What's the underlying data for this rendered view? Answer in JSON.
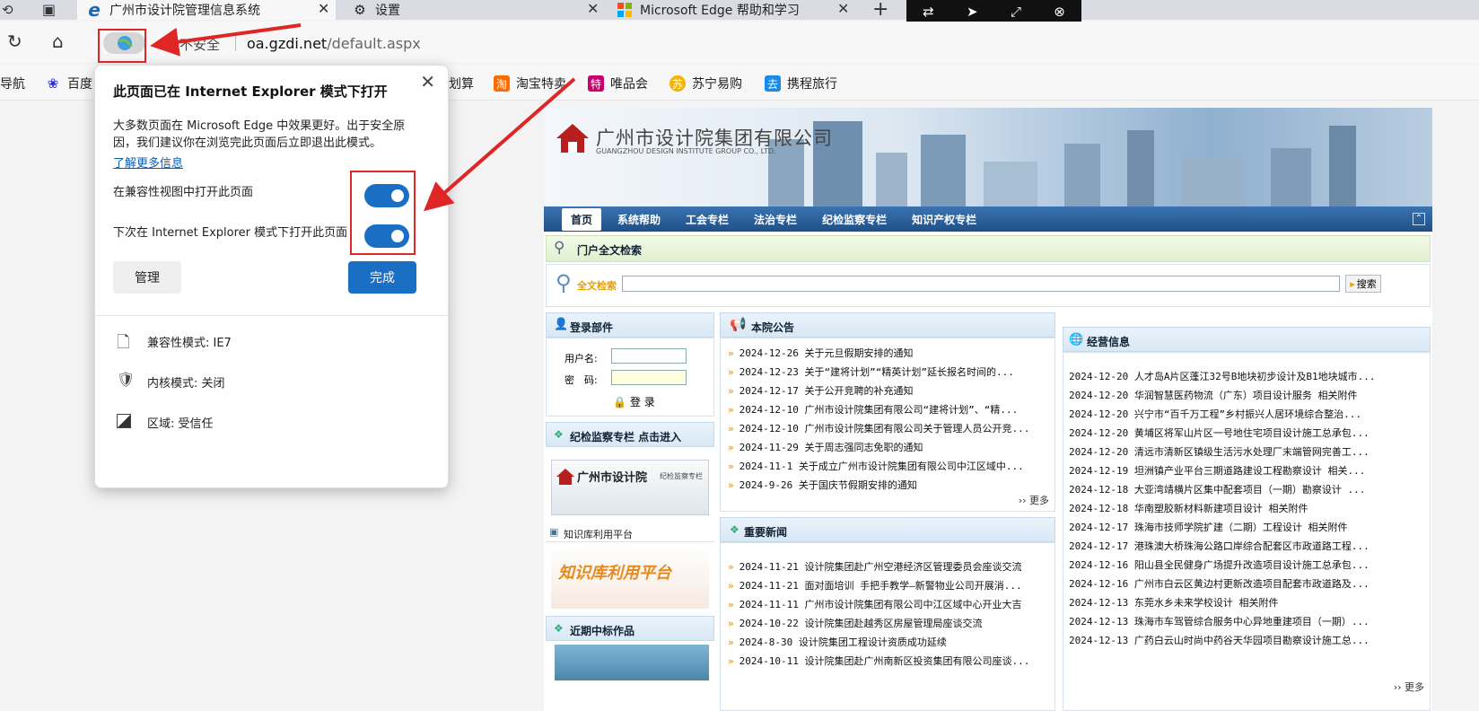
{
  "tabs": [
    {
      "label": "广州市设计院管理信息系统",
      "icon": "ie-icon"
    },
    {
      "label": "设置",
      "icon": "gear-icon"
    },
    {
      "label": "Microsoft Edge 帮助和学习",
      "icon": "microsoft-logo-icon"
    }
  ],
  "address": {
    "security": "不安全",
    "domain": "oa.gzdi.net",
    "path": "/default.aspx"
  },
  "bookmarks": [
    "导航",
    "百度",
    "划算",
    "淘宝特卖",
    "唯品会",
    "苏宁易购",
    "携程旅行"
  ],
  "popup": {
    "title": "此页面已在 Internet Explorer 模式下打开",
    "body": "大多数页面在 Microsoft Edge 中效果更好。出于安全原因，我们建议你在浏览完此页面后立即退出此模式。",
    "learn_more": "了解更多信息",
    "toggle1": "在兼容性视图中打开此页面",
    "toggle2": "下次在 Internet Explorer 模式下打开此页面",
    "manage": "管理",
    "done": "完成",
    "compat": "兼容性模式: IE7",
    "kernel": "内核模式: 关闭",
    "zone": "区域: 受信任"
  },
  "site": {
    "company": "广州市设计院集团有限公司",
    "company_en": "GUANGZHOU DESIGN INSTITUTE GROUP CO., LTD.",
    "nav": [
      "首页",
      "系统帮助",
      "工会专栏",
      "法治专栏",
      "纪检监察专栏",
      "知识产权专栏"
    ],
    "search_title": "门户全文检索",
    "search_label": "全文检索",
    "search_btn": "搜索",
    "login_title": "登录部件",
    "username": "用户名:",
    "password": "密　码:",
    "login_btn": "登 录",
    "discipline_title": "纪检监察专栏 点击进入",
    "discipline_banner": "广州市设计院",
    "discipline_sub": "纪检监察专栏",
    "knowledge_title": "知识库利用平台",
    "knowledge_banner": "知识库利用平台",
    "bids_title": "近期中标作品",
    "notice_title": "本院公告",
    "notices": [
      "2024-12-26 关于元旦假期安排的通知",
      "2024-12-23 关于“建将计划”“精英计划”延长报名时间的...",
      "2024-12-17 关于公开竞聘的补充通知",
      "2024-12-10 广州市设计院集团有限公司“建将计划”、“精...",
      "2024-12-10 广州市设计院集团有限公司关于管理人员公开竞...",
      "2024-11-29 关于周志强同志免职的通知",
      "2024-11-1 关于成立广州市设计院集团有限公司中江区域中...",
      "2024-9-26 关于国庆节假期安排的通知"
    ],
    "more": "›› 更多",
    "news_title": "重要新闻",
    "news": [
      "2024-11-21 设计院集团赴广州空港经济区管理委员会座谈交流",
      "2024-11-21 面对面培训 手把手教学—新警物业公司开展消...",
      "2024-11-11 广州市设计院集团有限公司中江区域中心开业大吉",
      "2024-10-22 设计院集团赴越秀区房屋管理局座谈交流",
      "2024-8-30 设计院集团工程设计资质成功延续",
      "2024-10-11 设计院集团赴广州南新区投资集团有限公司座谈..."
    ],
    "business_title": "经营信息",
    "business": [
      "2024-12-20 人才岛A片区蓬江32号B地块初步设计及B1地块城市...",
      "2024-12-20 华润智慧医药物流（广东）项目设计服务 相关附件",
      "2024-12-20 兴宁市“百千万工程”乡村振兴人居环境综合整治...",
      "2024-12-20 黄埔区将军山片区一号地住宅项目设计施工总承包...",
      "2024-12-20 清远市清新区镇级生活污水处理厂末端管网完善工...",
      "2024-12-19 坦洲镇产业平台三期道路建设工程勘察设计 相关...",
      "2024-12-18 大亚湾靖横片区集中配套项目（一期）勘察设计 ...",
      "2024-12-18 华南塑胶新材料新建项目设计 相关附件",
      "2024-12-17 珠海市技师学院扩建（二期）工程设计 相关附件",
      "2024-12-17 港珠澳大桥珠海公路口岸综合配套区市政道路工程...",
      "2024-12-16 阳山县全民健身广场提升改造项目设计施工总承包...",
      "2024-12-16 广州市白云区黄边村更新改造项目配套市政道路及...",
      "2024-12-13 东莞水乡未来学校设计 相关附件",
      "2024-12-13 珠海市车驾管综合服务中心异地重建项目（一期）...",
      "2024-12-13 广药白云山时尚中药谷天华园项目勘察设计施工总..."
    ]
  },
  "colors": {
    "accent": "#1a6fc4",
    "annotation": "#e02525",
    "nav_bg": "#2b5f9b"
  }
}
